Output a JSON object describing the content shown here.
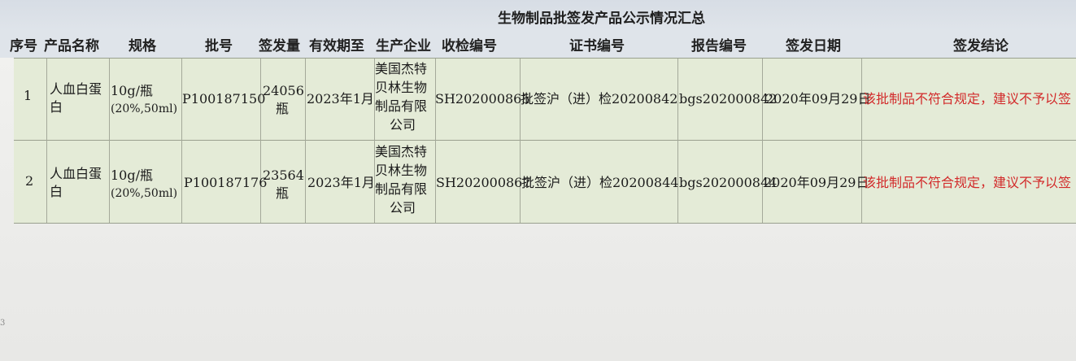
{
  "title": "生物制品批签发产品公示情况汇总",
  "headers": [
    "序号",
    "产品名称",
    "规格",
    "批号",
    "签发量",
    "有效期至",
    "生产企业",
    "收检编号",
    "证书编号",
    "报告编号",
    "签发日期",
    "签发结论"
  ],
  "rows": [
    {
      "index": "1",
      "product_line1": "人血白蛋",
      "product_line2": "白",
      "spec_line1": "10g/瓶",
      "spec_line2": "(20%,50ml)",
      "batch": "P100187150",
      "quantity_line1": "24056",
      "quantity_line2": "瓶",
      "expiry": "2023年1月",
      "maker_line1": "美国杰特",
      "maker_line2": "贝林生物",
      "maker_line3": "制品有限",
      "maker_line4": "公司",
      "inspection_no": "SH202000865",
      "certificate_no": "批签沪（进）检20200842",
      "report_no": "bgs202000842",
      "issue_date": "2020年09月29日",
      "conclusion": "该批制品不符合规定，建议不予以签"
    },
    {
      "index": "2",
      "product_line1": "人血白蛋",
      "product_line2": "白",
      "spec_line1": "10g/瓶",
      "spec_line2": "(20%,50ml)",
      "batch": "P100187176",
      "quantity_line1": "23564",
      "quantity_line2": "瓶",
      "expiry": "2023年1月",
      "maker_line1": "美国杰特",
      "maker_line2": "贝林生物",
      "maker_line3": "制品有限",
      "maker_line4": "公司",
      "inspection_no": "SH202000867",
      "certificate_no": "批签沪（进）检20200844",
      "report_no": "bgs202000844",
      "issue_date": "2020年09月29日",
      "conclusion": "该批制品不符合规定，建议不予以签"
    }
  ],
  "edge_glyph": "3"
}
